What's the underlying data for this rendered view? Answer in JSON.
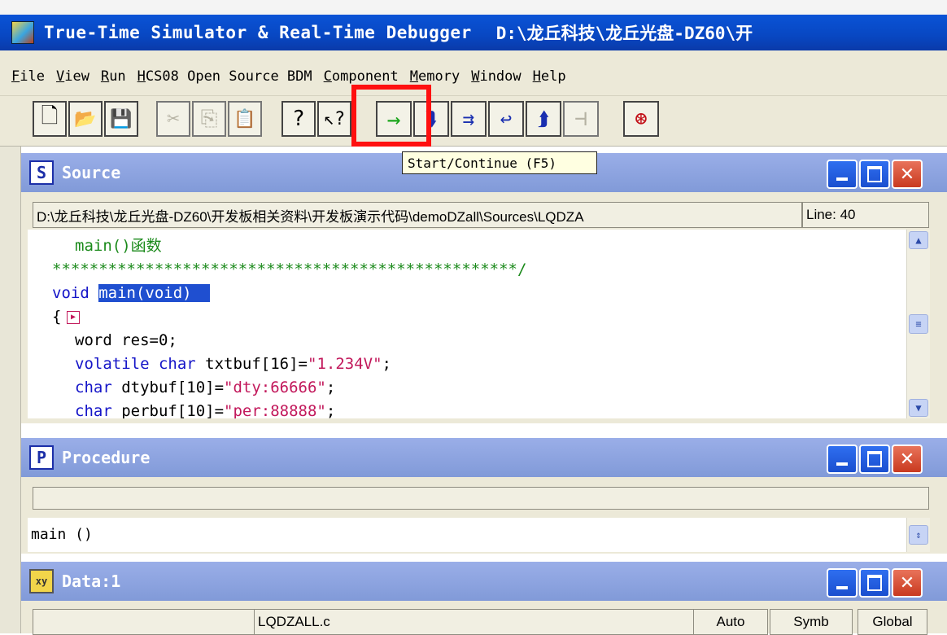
{
  "titlebar": {
    "app_title": "True-Time Simulator & Real-Time Debugger",
    "path": "D:\\龙丘科技\\龙丘光盘-DZ60\\开"
  },
  "menu": [
    "File",
    "View",
    "Run",
    "HCS08 Open Source BDM",
    "Component",
    "Memory",
    "Window",
    "Help"
  ],
  "tooltip": "Start/Continue (F5)",
  "source": {
    "title": "Source",
    "icon_letter": "S",
    "path": "D:\\龙丘科技\\龙丘光盘-DZ60\\开发板相关资料\\开发板演示代码\\demoDZall\\Sources\\LQDZA",
    "line": "Line: 40",
    "code_lines": [
      "main()函数",
      "**************************************************/",
      "void main(void)",
      "{",
      "word res=0;",
      "volatile char txtbuf[16]=\"1.234V\";",
      "char dtybuf[10]=\"dty:66666\";",
      "char perbuf[10]=\"per:88888\";"
    ]
  },
  "procedure": {
    "title": "Procedure",
    "icon_letter": "P",
    "entry": "main ()"
  },
  "data": {
    "title": "Data:1",
    "file": "LQDZALL.c",
    "buttons": [
      "Auto",
      "Symb",
      "Global"
    ]
  },
  "colors": {
    "accent": "#0a3aa9",
    "keyword": "#1515c8",
    "comment": "#1b8a1b",
    "string": "#c2185b",
    "selection": "#1f4fd0"
  }
}
